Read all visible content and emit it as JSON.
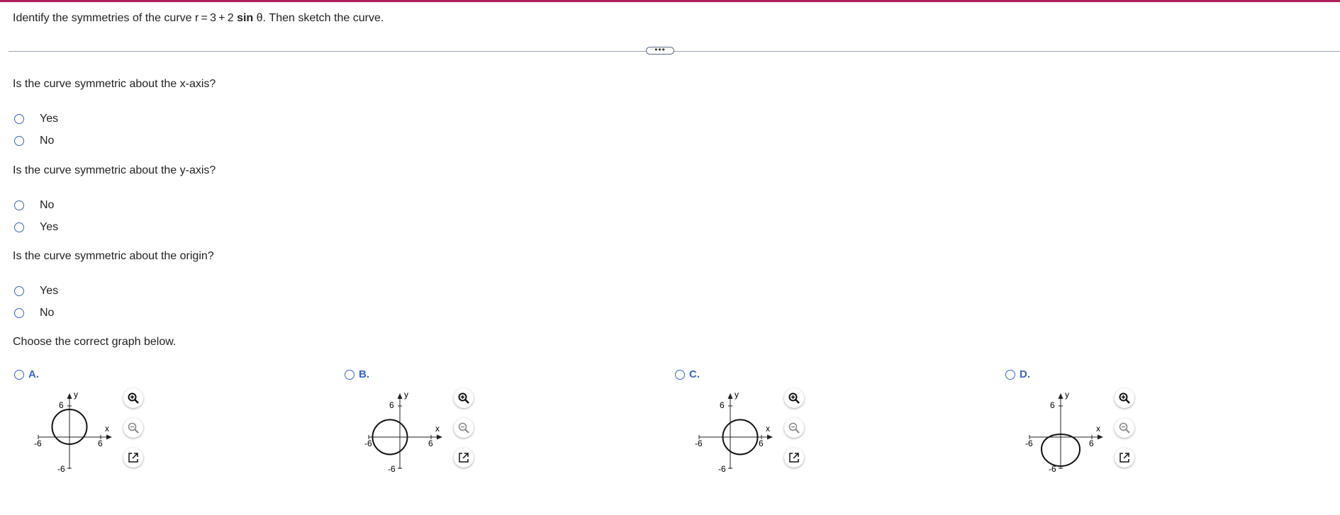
{
  "prompt": {
    "text_before": "Identify the symmetries of the curve r = 3 + 2 ",
    "bold": "sin",
    "text_after": " θ. Then sketch the curve."
  },
  "more_button": "•••",
  "questions": [
    {
      "text": "Is the curve symmetric about the x-axis?",
      "options": [
        "Yes",
        "No"
      ]
    },
    {
      "text": "Is the curve symmetric about the y-axis?",
      "options": [
        "No",
        "Yes"
      ]
    },
    {
      "text": "Is the curve symmetric about the origin?",
      "options": [
        "Yes",
        "No"
      ]
    }
  ],
  "choose_label": "Choose the correct graph below.",
  "choices": [
    {
      "letter": "A.",
      "x_label": "x",
      "y_label": "y",
      "tick_pos": "6",
      "tick_neg": "-6",
      "y_tick_pos": "6",
      "y_tick_neg": "-6"
    },
    {
      "letter": "B.",
      "x_label": "x",
      "y_label": "y",
      "tick_pos": "6",
      "tick_neg": "-6",
      "y_tick_pos": "6",
      "y_tick_neg": "-6"
    },
    {
      "letter": "C.",
      "x_label": "x",
      "y_label": "y",
      "tick_pos": "6",
      "tick_neg": "-6",
      "y_tick_pos": "6",
      "y_tick_neg": "-6"
    },
    {
      "letter": "D.",
      "x_label": "x",
      "y_label": "y",
      "tick_pos": "6",
      "tick_neg": "-6",
      "y_tick_pos": "6",
      "y_tick_neg": "-6"
    }
  ],
  "icons": {
    "zoom_in": "zoom-in-icon",
    "zoom_out": "zoom-out-icon",
    "popout": "external-link-icon"
  },
  "colors": {
    "accent": "#3a63c0",
    "top_border": "#b01e5a"
  }
}
